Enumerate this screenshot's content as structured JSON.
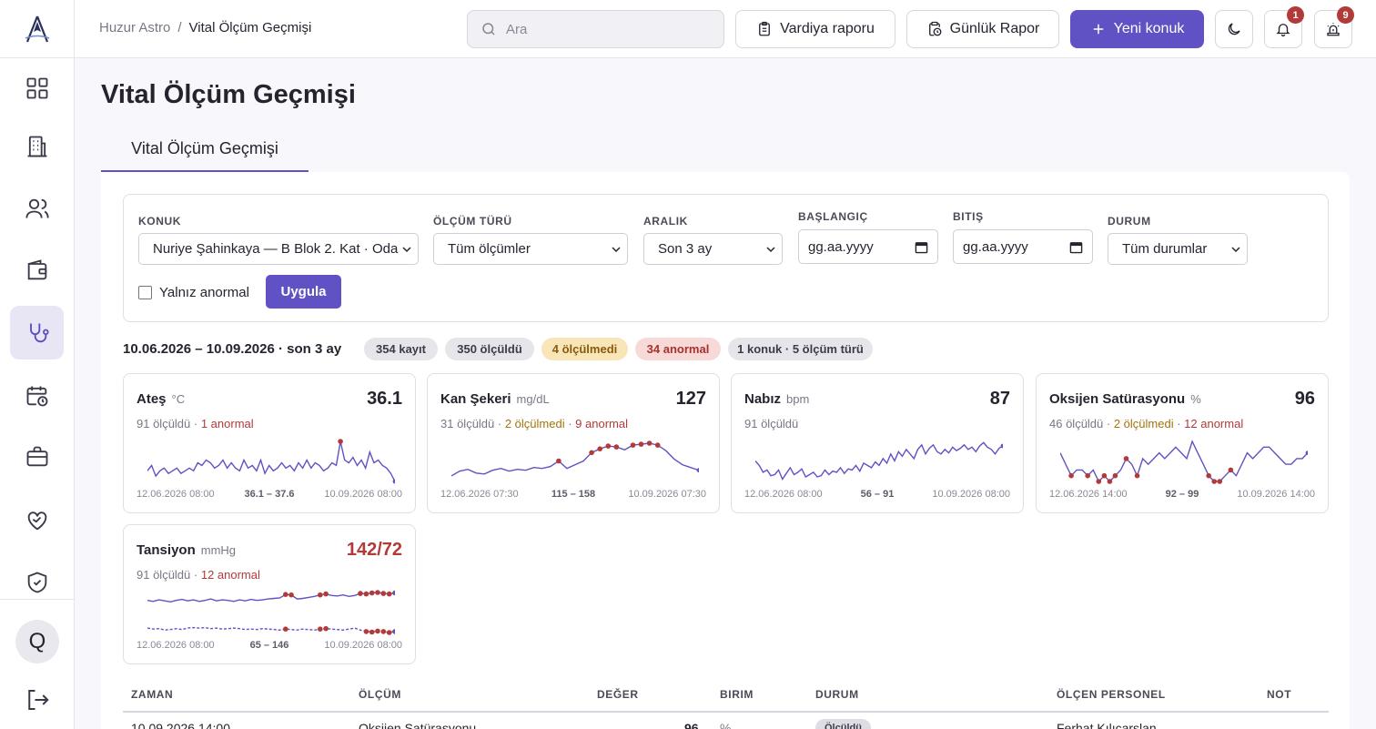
{
  "app": {
    "name": "Huzur Astro"
  },
  "header": {
    "breadcrumb_root": "Huzur Astro",
    "breadcrumb_sep": "/",
    "breadcrumb_current": "Vital Ölçüm Geçmişi",
    "search_placeholder": "Ara",
    "shift_report_label": "Vardiya raporu",
    "daily_report_label": "Günlük Rapor",
    "new_guest_label": "Yeni konuk",
    "notifications_count": "1",
    "alarms_count": "9"
  },
  "sidebar": {
    "items": [
      {
        "icon": "grid-icon"
      },
      {
        "icon": "building-icon"
      },
      {
        "icon": "users-icon"
      },
      {
        "icon": "wallet-icon"
      },
      {
        "icon": "stethoscope-icon",
        "active": true
      },
      {
        "icon": "calendar-clock-icon"
      },
      {
        "icon": "briefcase-icon"
      },
      {
        "icon": "heart-handshake-icon"
      },
      {
        "icon": "shield-check-icon"
      }
    ],
    "avatar_initial": "Q"
  },
  "page": {
    "title": "Vital Ölçüm Geçmişi",
    "tab_label": "Vital Ölçüm Geçmişi"
  },
  "filters": {
    "guest_label": "KONUK",
    "guest_value": "Nuriye Şahinkaya — B Blok 2. Kat · Oda 4",
    "type_label": "ÖLÇÜM TÜRÜ",
    "type_value": "Tüm ölçümler",
    "range_label": "ARALIK",
    "range_value": "Son 3 ay",
    "start_label": "BAŞLANGIÇ",
    "start_placeholder": "gg.aa.yyyy",
    "end_label": "BITIŞ",
    "end_placeholder": "gg.aa.yyyy",
    "status_label": "DURUM",
    "status_value": "Tüm durumlar",
    "abnormal_only_label": "Yalnız anormal",
    "abnormal_only_checked": false,
    "apply_label": "Uygula"
  },
  "summary": {
    "range": "10.06.2026 – 10.09.2026 · son 3 ay",
    "records": "354 kayıt",
    "measured": "350 ölçüldü",
    "not_measured": "4 ölçülmedi",
    "abnormal": "34 anormal",
    "scope": "1 konuk · 5 ölçüm türü"
  },
  "vitals": [
    {
      "name": "Ateş",
      "unit": "°C",
      "value": "36.1",
      "alert": false,
      "measured": "91 ölçüldü",
      "not_measured": "",
      "abnormal": "1 anormal",
      "first": "12.06.2026 08:00",
      "range": "36.1 – 37.6",
      "last": "10.09.2026 08:00",
      "ymin": 36.1,
      "ymax": 37.6,
      "series": [
        36.5,
        36.7,
        36.3,
        36.5,
        36.6,
        36.4,
        36.5,
        36.6,
        36.4,
        36.5,
        36.6,
        36.5,
        36.8,
        36.7,
        36.9,
        36.8,
        36.6,
        36.7,
        36.9,
        36.6,
        36.8,
        36.6,
        36.5,
        36.9,
        36.6,
        36.7,
        36.5,
        36.9,
        36.4,
        36.7,
        36.5,
        36.6,
        36.8,
        36.6,
        36.7,
        36.5,
        36.8,
        36.6,
        36.9,
        36.6,
        36.8,
        36.7,
        36.5,
        36.6,
        36.8,
        36.7,
        37.6,
        36.9,
        36.8,
        37.0,
        36.7,
        36.9,
        36.6,
        37.2,
        36.8,
        36.9,
        36.7,
        36.6,
        36.4,
        36.1
      ],
      "abnormal_idx": [
        46
      ],
      "series2": null,
      "abnormal_idx2": []
    },
    {
      "name": "Kan Şekeri",
      "unit": "mg/dL",
      "value": "127",
      "alert": false,
      "measured": "31 ölçüldü",
      "not_measured": "2 ölçülmedi",
      "abnormal": "9 anormal",
      "first": "12.06.2026 07:30",
      "range": "115 – 158",
      "last": "10.09.2026 07:30",
      "ymin": 115,
      "ymax": 158,
      "series": [
        121,
        126,
        128,
        124,
        123,
        127,
        129,
        126,
        128,
        127,
        130,
        129,
        131,
        137,
        129,
        133,
        137,
        146,
        150,
        153,
        152,
        149,
        154,
        155,
        156,
        154,
        148,
        139,
        133,
        130,
        127
      ],
      "abnormal_idx": [
        13,
        17,
        18,
        19,
        20,
        22,
        23,
        24,
        25
      ],
      "series2": null,
      "abnormal_idx2": []
    },
    {
      "name": "Nabız",
      "unit": "bpm",
      "value": "87",
      "alert": false,
      "measured": "91 ölçüldü",
      "not_measured": "",
      "abnormal": "",
      "first": "12.06.2026 08:00",
      "range": "56 – 91",
      "last": "10.09.2026 08:00",
      "ymin": 56,
      "ymax": 91,
      "series": [
        74,
        70,
        64,
        66,
        61,
        62,
        66,
        58,
        63,
        68,
        62,
        64,
        67,
        60,
        62,
        64,
        60,
        61,
        66,
        62,
        65,
        64,
        68,
        63,
        67,
        66,
        70,
        65,
        72,
        70,
        68,
        73,
        70,
        76,
        72,
        80,
        74,
        82,
        78,
        84,
        80,
        76,
        84,
        88,
        80,
        85,
        88,
        82,
        80,
        84,
        81,
        86,
        83,
        85,
        88,
        84,
        86,
        82,
        87,
        90,
        86,
        84,
        80,
        85,
        87
      ],
      "abnormal_idx": [],
      "series2": null,
      "abnormal_idx2": []
    },
    {
      "name": "Oksijen Satürasyonu",
      "unit": "%",
      "value": "96",
      "alert": false,
      "measured": "46 ölçüldü",
      "not_measured": "2 ölçülmedi",
      "abnormal": "12 anormal",
      "first": "12.06.2026 14:00",
      "range": "92 – 99",
      "last": "10.09.2026 14:00",
      "ymin": 92,
      "ymax": 99,
      "series": [
        97,
        95,
        93,
        94,
        94,
        93,
        94,
        92,
        93,
        92,
        93,
        94,
        96,
        95,
        93,
        96,
        95,
        96,
        97,
        96,
        97,
        98,
        97,
        96,
        99,
        97,
        95,
        93,
        92,
        92,
        93,
        94,
        93,
        95,
        97,
        96,
        97,
        98,
        98,
        97,
        96,
        95,
        95,
        96,
        96,
        97
      ],
      "abnormal_idx": [
        2,
        5,
        7,
        8,
        9,
        10,
        12,
        14,
        27,
        28,
        29,
        31
      ],
      "series2": null,
      "abnormal_idx2": []
    },
    {
      "name": "Tansiyon",
      "unit": "mmHg",
      "value": "142/72",
      "alert": true,
      "measured": "91 ölçüldü",
      "not_measured": "",
      "abnormal": "12 anormal",
      "first": "12.06.2026 08:00",
      "range": "65 – 146",
      "last": "10.09.2026 08:00",
      "ymin": 65,
      "ymax": 146,
      "series": [
        130,
        128,
        131,
        129,
        127,
        130,
        132,
        129,
        131,
        128,
        130,
        133,
        129,
        131,
        130,
        128,
        131,
        129,
        132,
        130,
        131,
        133,
        134,
        135,
        142,
        141,
        133,
        134,
        136,
        138,
        141,
        143,
        140,
        139,
        141,
        138,
        140,
        144,
        143,
        145,
        146,
        144,
        143,
        145
      ],
      "abnormal_idx": [
        24,
        25,
        30,
        31,
        37,
        38,
        39,
        40,
        41,
        42,
        43
      ],
      "series2": [
        74,
        72,
        73,
        70,
        71,
        73,
        71,
        74,
        75,
        74,
        75,
        73,
        74,
        72,
        73,
        74,
        73,
        71,
        72,
        71,
        73,
        72,
        71,
        70,
        72,
        71,
        70,
        72,
        71,
        70,
        72,
        73,
        72,
        71,
        70,
        72,
        74,
        70,
        67,
        66,
        68,
        67,
        65,
        67
      ],
      "abnormal_idx2": [
        24,
        30,
        31,
        38,
        39,
        40,
        41,
        42,
        43
      ]
    }
  ],
  "table": {
    "columns": [
      "ZAMAN",
      "ÖLÇÜM",
      "DEĞER",
      "BIRIM",
      "DURUM",
      "ÖLÇEN PERSONEL",
      "NOT"
    ],
    "rows": [
      {
        "time": "10.09.2026 14:00",
        "type": "Oksijen Satürasyonu",
        "value": "96",
        "unit": "%",
        "status": "Ölçüldü",
        "staff": "Ferhat Kılıçarslan",
        "note": ""
      }
    ]
  },
  "colors": {
    "accent": "#6052c4",
    "danger": "#b23a38",
    "warning": "#a5720c"
  }
}
